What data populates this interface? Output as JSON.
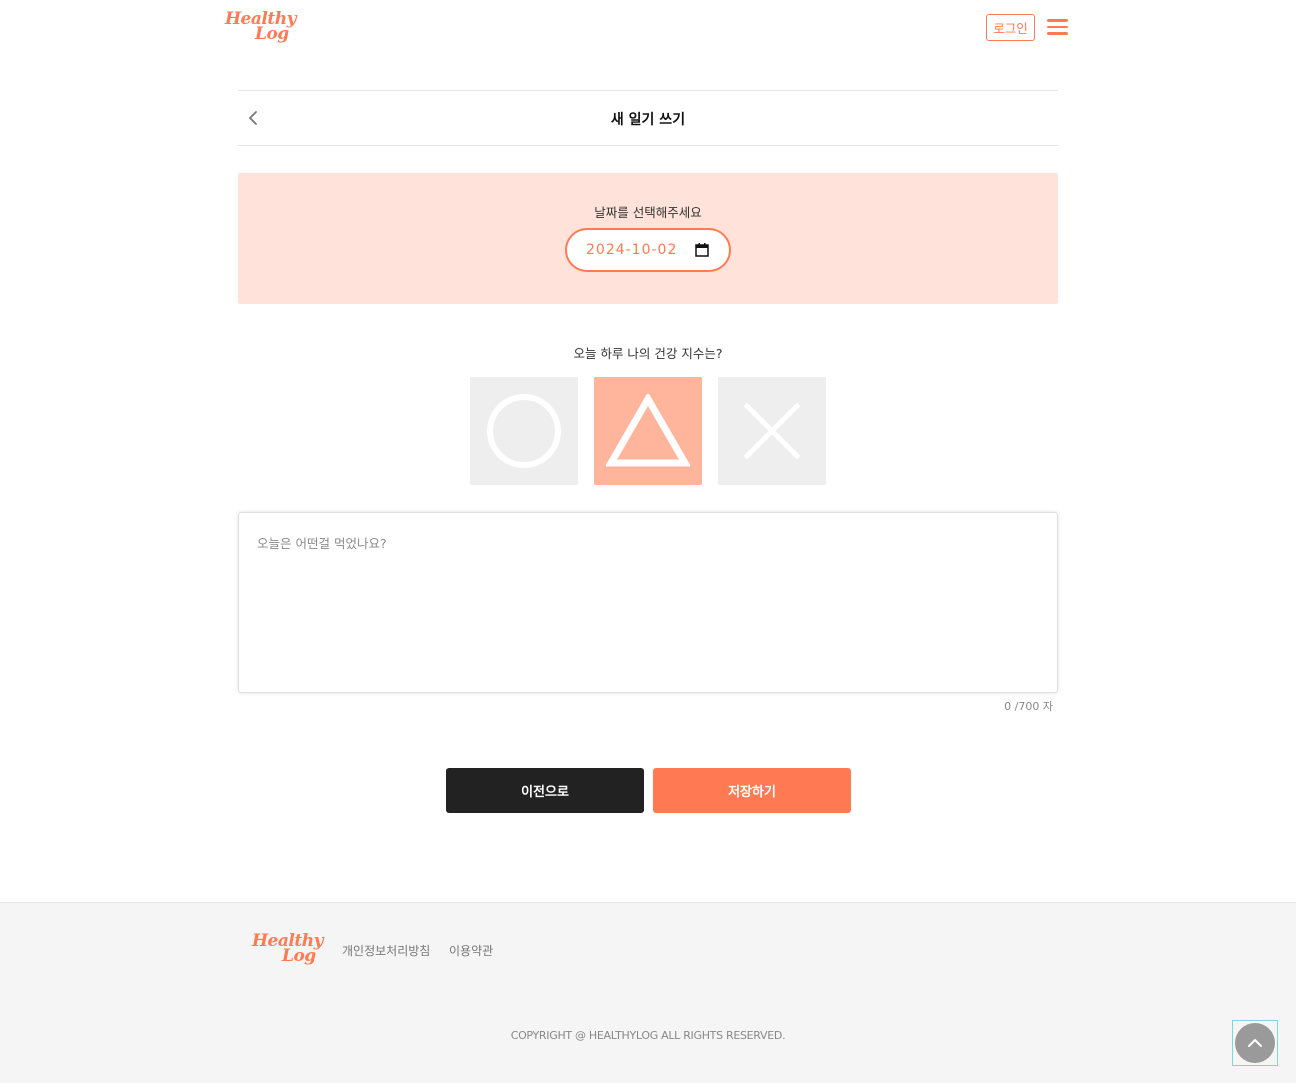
{
  "header": {
    "logo_line1": "Healthy",
    "logo_line2": "Log",
    "login_label": "로그인"
  },
  "titlebar": {
    "title": "새 일기 쓰기"
  },
  "date_panel": {
    "label": "날짜를 선택해주세요",
    "date_value": "2024-10-02"
  },
  "health": {
    "question": "오늘 하루 나의 건강 지수는?",
    "options": [
      {
        "name": "good",
        "symbol": "circle",
        "selected": false
      },
      {
        "name": "normal",
        "symbol": "triangle",
        "selected": true
      },
      {
        "name": "bad",
        "symbol": "cross",
        "selected": false
      }
    ]
  },
  "diary": {
    "placeholder": "오늘은 어떤걸 먹었나요?",
    "char_count": "0 /700 자"
  },
  "actions": {
    "prev_label": "이전으로",
    "save_label": "저장하기"
  },
  "footer": {
    "logo_line1": "Healthy",
    "logo_line2": "Log",
    "privacy_link": "개인정보처리방침",
    "terms_link": "이용약관",
    "copyright": "COPYRIGHT @ HEALTHYLOG ALL RIGHTS RESERVED."
  },
  "colors": {
    "brand": "#ff7a52",
    "date_panel_bg": "#ffe3da",
    "selected_option_bg": "#ffb59b",
    "option_bg": "#eeeeee",
    "dark_button": "#222222"
  },
  "icons": {
    "menu": "hamburger-icon",
    "back": "chevron-left-icon",
    "calendar": "calendar-icon",
    "scroll_top": "chevron-up-icon"
  }
}
